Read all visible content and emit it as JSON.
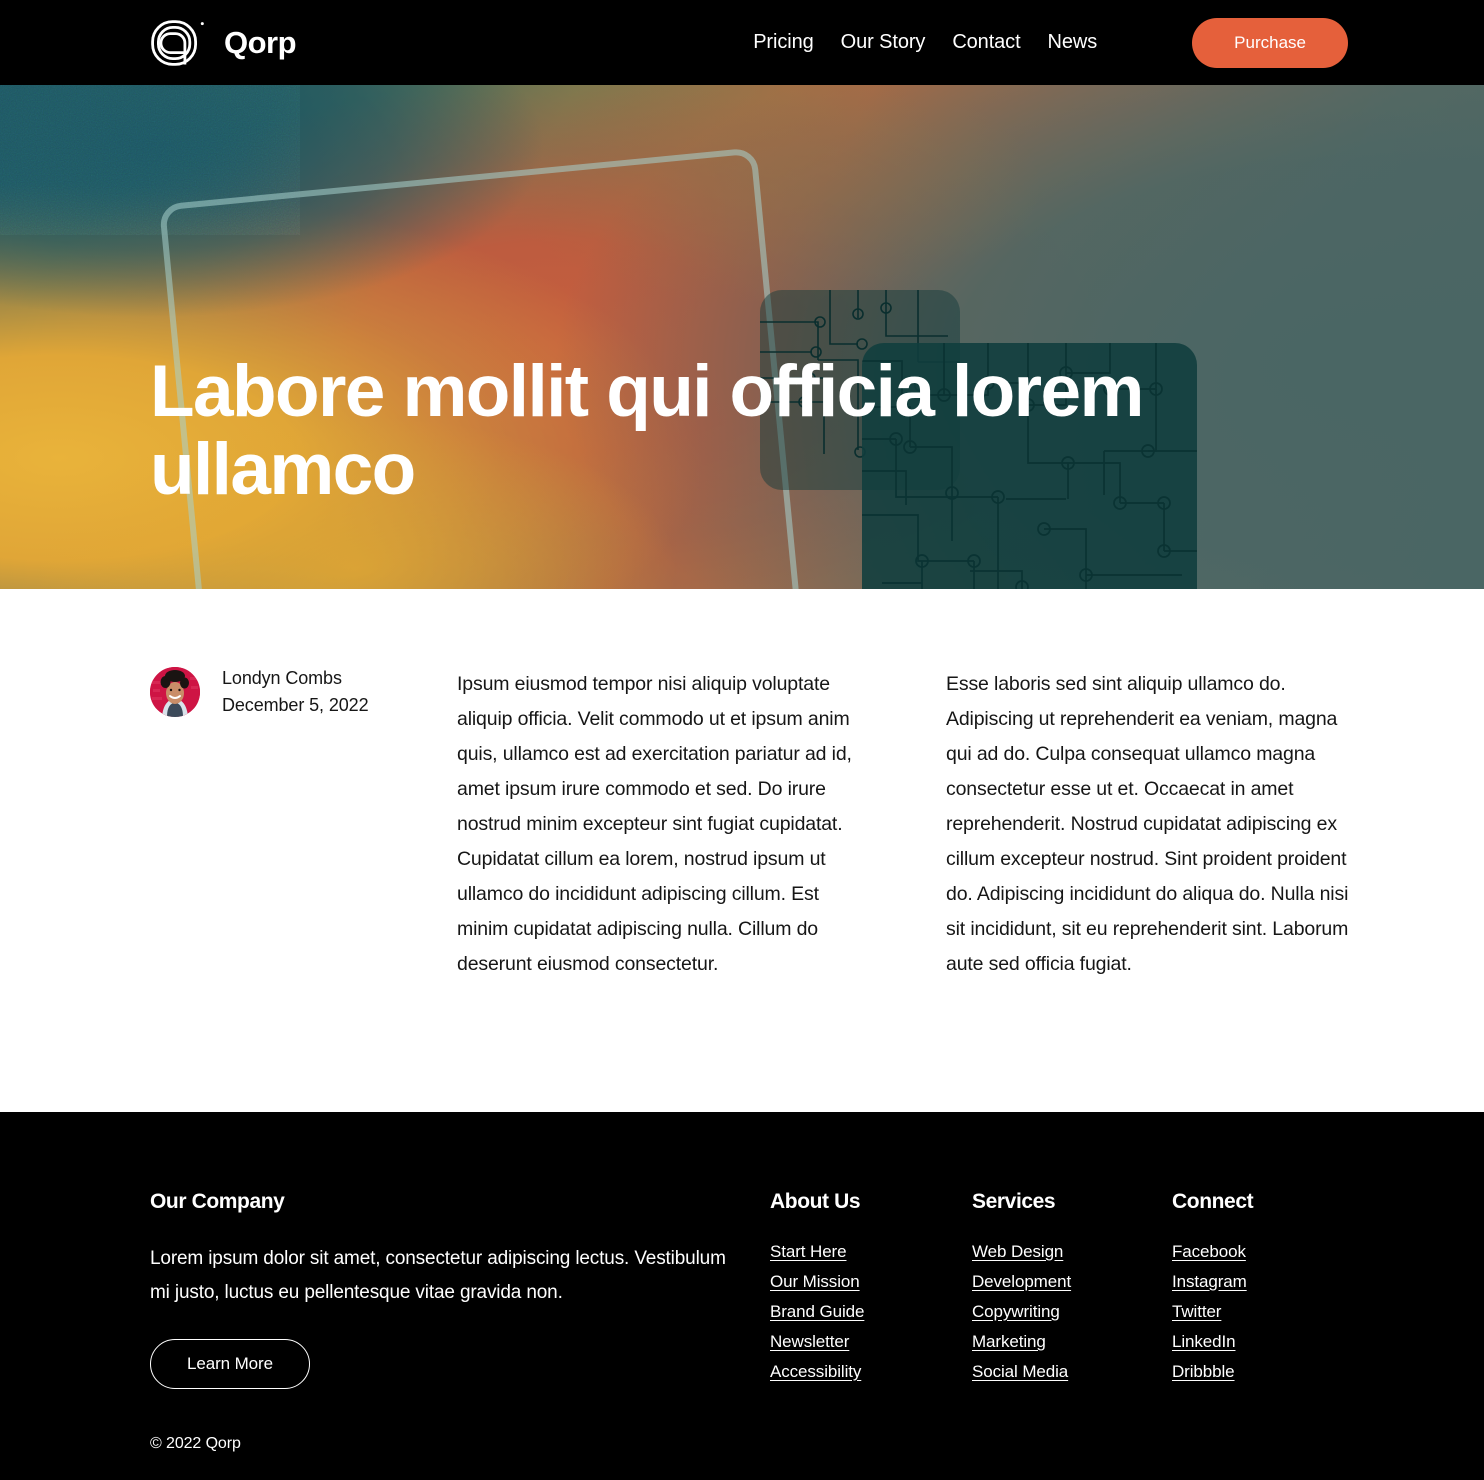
{
  "header": {
    "brand_name": "Qorp",
    "logo_icon": "qorp-spiral-logo",
    "nav": [
      {
        "label": "Pricing"
      },
      {
        "label": "Our Story"
      },
      {
        "label": "Contact"
      },
      {
        "label": "News"
      }
    ],
    "purchase_label": "Purchase",
    "accent_color": "#E5603B",
    "background_color": "#000000"
  },
  "hero": {
    "title": "Labore mollit qui officia lorem ullamco",
    "gradient_colors": [
      "#1F5660",
      "#E9B33A",
      "#C75F3E",
      "#4A6663"
    ],
    "card_color": "#0F3E3E",
    "outline_color": "#A8D2CD"
  },
  "article": {
    "author": {
      "name": "Londyn Combs",
      "date": "December 5, 2022",
      "avatar_icon": "author-avatar"
    },
    "columns": [
      "Ipsum eiusmod tempor nisi aliquip voluptate aliquip officia. Velit commodo ut et ipsum anim quis, ullamco est ad exercitation pariatur ad id, amet ipsum irure commodo et sed. Do irure nostrud minim excepteur sint fugiat cupidatat. Cupidatat cillum ea lorem, nostrud ipsum ut ullamco do incididunt adipiscing cillum. Est minim cupidatat adipiscing nulla. Cillum do deserunt eiusmod consectetur.",
      "Esse laboris sed sint aliquip ullamco do. Adipiscing ut reprehenderit ea veniam, magna qui ad do. Culpa consequat ullamco magna consectetur esse ut et. Occaecat in amet reprehenderit. Nostrud cupidatat adipiscing ex cillum excepteur nostrud. Sint proident proident do. Adipiscing incididunt do aliqua do. Nulla nisi sit incididunt, sit eu reprehenderit sint. Laborum aute sed officia fugiat."
    ]
  },
  "footer": {
    "company": {
      "heading": "Our Company",
      "description": "Lorem ipsum dolor sit amet, consectetur adipiscing lectus. Vestibulum mi justo, luctus eu pellentesque vitae gravida non.",
      "cta_label": "Learn More"
    },
    "about": {
      "heading": "About Us",
      "links": [
        "Start Here",
        "Our Mission",
        "Brand Guide",
        "Newsletter",
        "Accessibility"
      ]
    },
    "services": {
      "heading": "Services",
      "links": [
        "Web Design",
        "Development",
        "Copywriting",
        "Marketing",
        "Social Media"
      ]
    },
    "connect": {
      "heading": "Connect",
      "links": [
        "Facebook",
        "Instagram",
        "Twitter",
        "LinkedIn",
        "Dribbble"
      ]
    },
    "copyright": "© 2022 Qorp",
    "background_color": "#000000"
  }
}
